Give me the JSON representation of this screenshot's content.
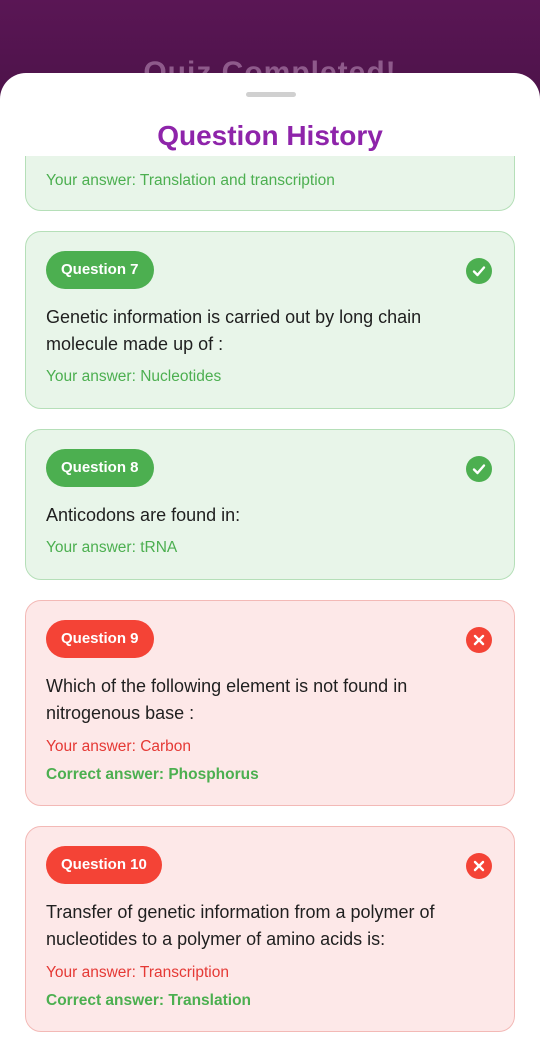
{
  "background": {
    "title": "Quiz Completed!"
  },
  "sheet": {
    "title": "Question History"
  },
  "cards": [
    {
      "your_answer": "Your answer: Translation and transcription"
    },
    {
      "label": "Question 7",
      "status": "correct",
      "question": "Genetic information is carried out by long chain molecule made up of :",
      "your_answer": "Your answer: Nucleotides"
    },
    {
      "label": "Question 8",
      "status": "correct",
      "question": "Anticodons are found in:",
      "your_answer": "Your answer: tRNA"
    },
    {
      "label": "Question 9",
      "status": "incorrect",
      "question": "Which of the following element is not found in nitrogenous base :",
      "your_answer": "Your answer: Carbon",
      "correct_answer": "Correct answer: Phosphorus"
    },
    {
      "label": "Question 10",
      "status": "incorrect",
      "question": "Transfer of genetic information from a polymer of nucleotides to a polymer of amino acids is:",
      "your_answer": "Your answer: Transcription",
      "correct_answer": "Correct answer: Translation"
    }
  ],
  "icons": {
    "correct": "check-circle-icon",
    "incorrect": "x-circle-icon"
  },
  "colors": {
    "accent": "#8e24aa",
    "correct": "#4caf50",
    "incorrect": "#f44336",
    "correct_bg": "#e8f5e9",
    "incorrect_bg": "#fde8e8"
  }
}
